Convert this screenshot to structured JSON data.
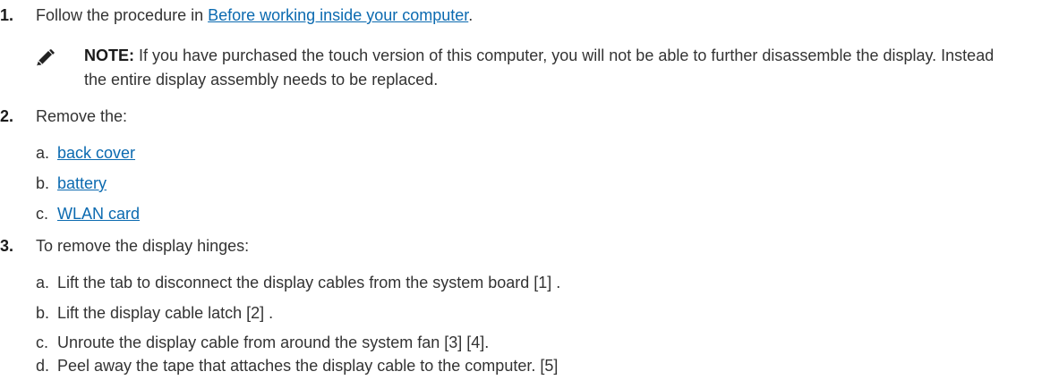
{
  "steps": [
    {
      "number": "1.",
      "text_before": "Follow the procedure in ",
      "link": "Before working inside your computer",
      "text_after": "."
    },
    {
      "number": "2.",
      "text": "Remove the:",
      "subitems": [
        {
          "letter": "a.",
          "link": "back cover"
        },
        {
          "letter": "b.",
          "link": "battery"
        },
        {
          "letter": "c.",
          "link": "WLAN card"
        }
      ]
    },
    {
      "number": "3.",
      "text": "To remove the display hinges:",
      "subitems": [
        {
          "letter": "a.",
          "text": "Lift the tab to disconnect the display cables from the system board [1] ."
        },
        {
          "letter": "b.",
          "text": "Lift the display cable latch [2] ."
        },
        {
          "letter": "c.",
          "text": "Unroute the display cable from around the system fan [3] [4]."
        },
        {
          "letter": "d.",
          "text": "Peel away the tape that attaches the display cable to the computer. [5]"
        }
      ]
    }
  ],
  "note": {
    "icon": "pencil-note-icon",
    "label": "NOTE:",
    "text": " If you have purchased the touch version of this computer, you will not be able to further disassemble the display. Instead the entire display assembly needs to be replaced."
  },
  "colors": {
    "text": "#333333",
    "link": "#0b6ab0",
    "emphasis": "#1a1a1a"
  }
}
